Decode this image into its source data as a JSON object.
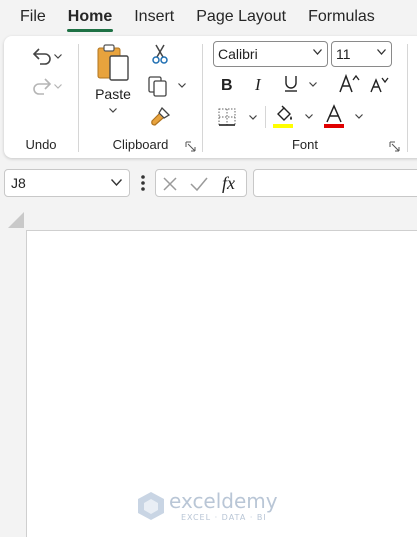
{
  "tabs": [
    {
      "label": "File"
    },
    {
      "label": "Home",
      "active": true
    },
    {
      "label": "Insert"
    },
    {
      "label": "Page Layout"
    },
    {
      "label": "Formulas"
    }
  ],
  "ribbon": {
    "undo": {
      "group_label": "Undo"
    },
    "clipboard": {
      "paste_label": "Paste",
      "group_label": "Clipboard"
    },
    "font": {
      "font_name": "Calibri",
      "font_size": "11",
      "group_label": "Font",
      "highlight_color": "#ffff00",
      "font_color": "#e00000"
    }
  },
  "formula_bar": {
    "name_box": "J8",
    "fx_label": "fx",
    "formula": ""
  },
  "watermark": {
    "brand": "exceldemy",
    "tagline": "EXCEL · DATA · BI"
  },
  "colors": {
    "accent": "#1e7145"
  }
}
